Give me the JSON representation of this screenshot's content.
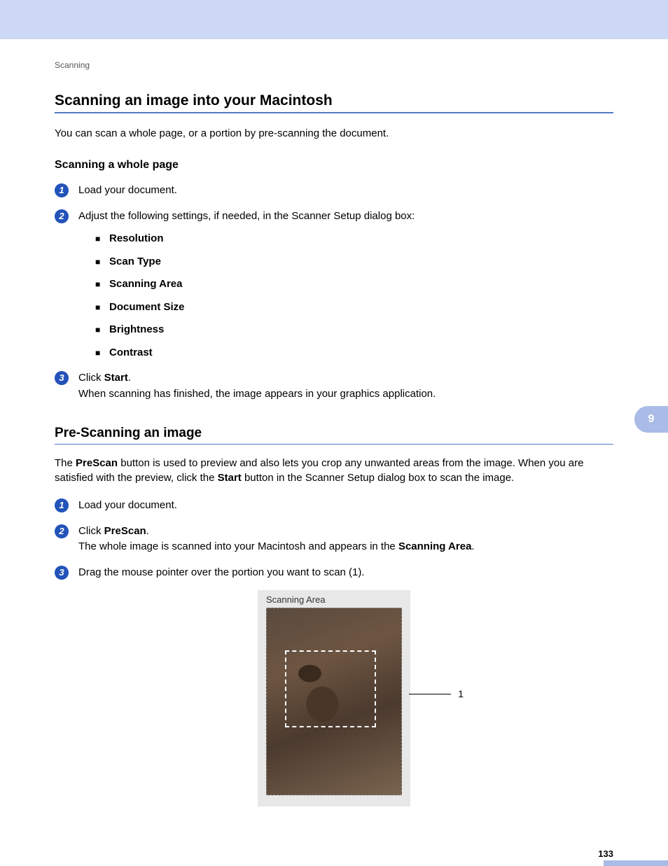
{
  "breadcrumb": "Scanning",
  "heading1": "Scanning an image into your Macintosh",
  "intro1": "You can scan a whole page, or a portion by pre-scanning the document.",
  "subheading1": "Scanning a whole page",
  "section1": {
    "step1": "Load your document.",
    "step2": "Adjust the following settings, if needed, in the Scanner Setup dialog box:",
    "bullets": {
      "b1": "Resolution",
      "b2": "Scan Type",
      "b3": "Scanning Area",
      "b4": "Document Size",
      "b5": "Brightness",
      "b6": "Contrast"
    },
    "step3_prefix": "Click ",
    "step3_bold": "Start",
    "step3_suffix": ".",
    "step3_line2": "When scanning has finished, the image appears in your graphics application."
  },
  "heading2": "Pre-Scanning an image",
  "intro2_pre": "The ",
  "intro2_b1": "PreScan",
  "intro2_mid": " button is used to preview and also lets you crop any unwanted areas from the image. When you are satisfied with the preview, click the ",
  "intro2_b2": "Start",
  "intro2_post": " button in the Scanner Setup dialog box to scan the image.",
  "section2": {
    "step1": "Load your document.",
    "step2_prefix": "Click ",
    "step2_bold": "PreScan",
    "step2_suffix": ".",
    "step2_line2_pre": "The whole image is scanned into your Macintosh and appears in the ",
    "step2_line2_bold": "Scanning Area",
    "step2_line2_post": ".",
    "step3": "Drag the mouse pointer over the portion you want to scan (1)."
  },
  "figure": {
    "panel_title": "Scanning Area",
    "callout": "1"
  },
  "sidetab": "9",
  "page_number": "133"
}
